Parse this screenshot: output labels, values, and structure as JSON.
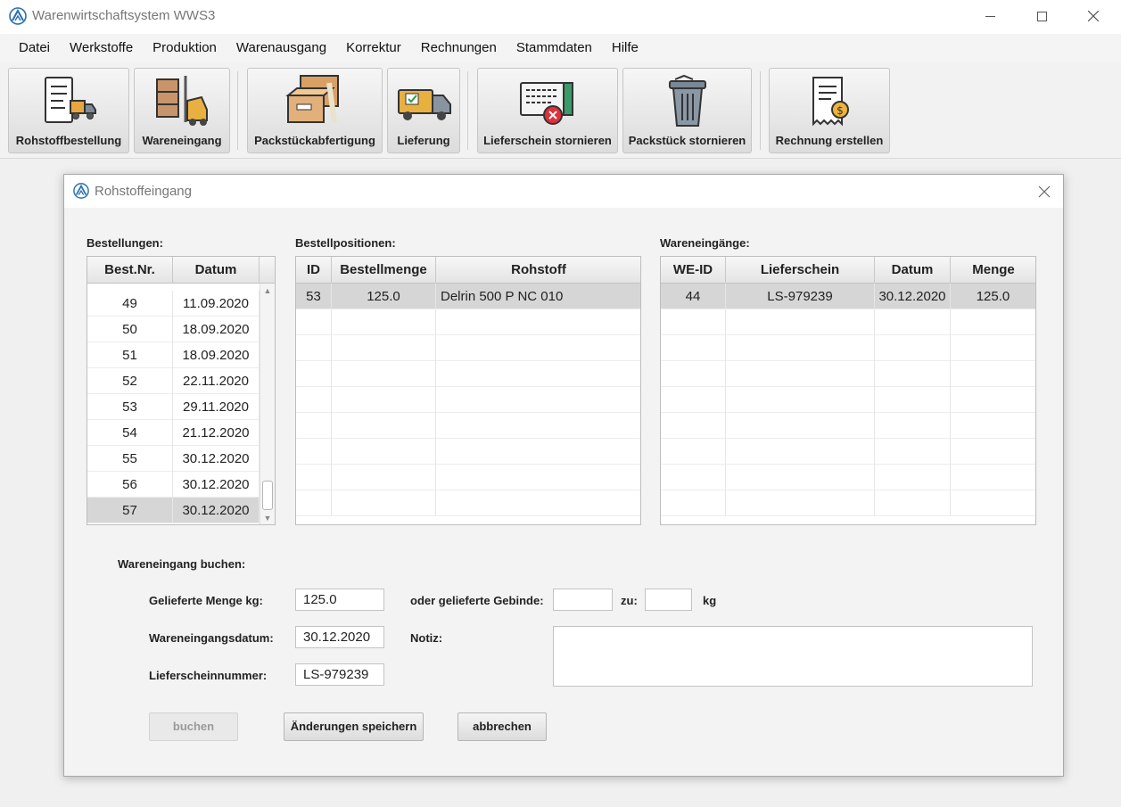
{
  "window": {
    "title": "Warenwirtschaftsystem WWS3"
  },
  "menu": [
    "Datei",
    "Werkstoffe",
    "Produktion",
    "Warenausgang",
    "Korrektur",
    "Rechnungen",
    "Stammdaten",
    "Hilfe"
  ],
  "toolbar": {
    "rohstoffbestellung": "Rohstoffbestellung",
    "wareneingang": "Wareneingang",
    "packstueckabfertigung": "Packstückabfertigung",
    "lieferung": "Lieferung",
    "lieferschein_stornieren": "Lieferschein stornieren",
    "packstueck_stornieren": "Packstück stornieren",
    "rechnung_erstellen": "Rechnung erstellen"
  },
  "dialog": {
    "title": "Rohstoffeingang",
    "bestellungen": {
      "label": "Bestellungen:",
      "headers": [
        "Best.Nr.",
        "Datum"
      ],
      "rows": [
        [
          "49",
          "11.09.2020"
        ],
        [
          "50",
          "18.09.2020"
        ],
        [
          "51",
          "18.09.2020"
        ],
        [
          "52",
          "22.11.2020"
        ],
        [
          "53",
          "29.11.2020"
        ],
        [
          "54",
          "21.12.2020"
        ],
        [
          "55",
          "30.12.2020"
        ],
        [
          "56",
          "30.12.2020"
        ],
        [
          "57",
          "30.12.2020"
        ]
      ],
      "selected": "57"
    },
    "bestellpositionen": {
      "label": "Bestellpositionen:",
      "headers": [
        "ID",
        "Bestellmenge",
        "Rohstoff"
      ],
      "rows": [
        [
          "53",
          "125.0",
          "Delrin 500 P NC 010"
        ]
      ]
    },
    "wareneingaenge": {
      "label": "Wareneingänge:",
      "headers": [
        "WE-ID",
        "Lieferschein",
        "Datum",
        "Menge"
      ],
      "rows": [
        [
          "44",
          "LS-979239",
          "30.12.2020",
          "125.0"
        ]
      ]
    },
    "form": {
      "section_label": "Wareneingang buchen:",
      "menge_label": "Gelieferte Menge kg:",
      "menge_value": "125.0",
      "gebinde_label": "oder gelieferte Gebinde:",
      "gebinde_value": "",
      "zu_label": "zu:",
      "zu_value": "",
      "kg_label": "kg",
      "datum_label": "Wareneingangsdatum:",
      "datum_value": "30.12.2020",
      "notiz_label": "Notiz:",
      "notiz_value": "",
      "lieferschein_label": "Lieferscheinnummer:",
      "lieferschein_value": "LS-979239"
    },
    "buttons": {
      "buchen": "buchen",
      "speichern": "Änderungen speichern",
      "abbrechen": "abbrechen"
    }
  }
}
